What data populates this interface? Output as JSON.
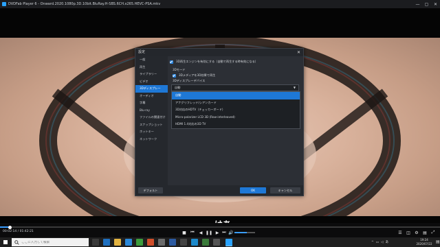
{
  "window": {
    "title": "DVDFab Player 6 - Onward.2020.1080p.3D.10bit.BluRay.H-SBS.6CH.x265.HEVC-PSA.mkv",
    "controls": [
      "—",
      "▢",
      "✕"
    ]
  },
  "dialog": {
    "title": "設定",
    "close": "✕",
    "sidebar": [
      "一般",
      "再生",
      "ライブラリー",
      "ビデオ",
      "3Dディスプレー",
      "オーディオ",
      "字幕",
      "Blu-ray",
      "ファイルの関連付け",
      "スナップショット",
      "ホットキー",
      "ネットワーク"
    ],
    "active_index": 4,
    "enable_engine_label": "3D再生エンジンを有効にする（自動で再生する時有効になる）",
    "section_3d_mode": "3Dモード",
    "play_3d_label": "3Dメディアを3D効果で再生",
    "device_label": "3Dディスプレーデバイス",
    "device_value": "自動",
    "device_options": [
      "自動",
      "アナグリフレッド/シアンカード",
      "3D対応のHDTV（チェッカーボード）",
      "Micro-polarizer LCD 3D (Row-interleaved)",
      "HDMI 1.4対応の3D TV"
    ],
    "selected_option": 0,
    "buttons": {
      "default": "デフォルト",
      "ok": "OK",
      "cancel": "キャンセル"
    }
  },
  "subtitle_text": "はあ",
  "player": {
    "time": "00:02:14 / 01:42:21",
    "progress": 0.022,
    "volume": 0.6,
    "accent": "#3b9dff"
  },
  "taskbar": {
    "search_placeholder": "ここに入力して検索",
    "time": "19:24",
    "date": "2020/07/22",
    "lang": "あ"
  }
}
